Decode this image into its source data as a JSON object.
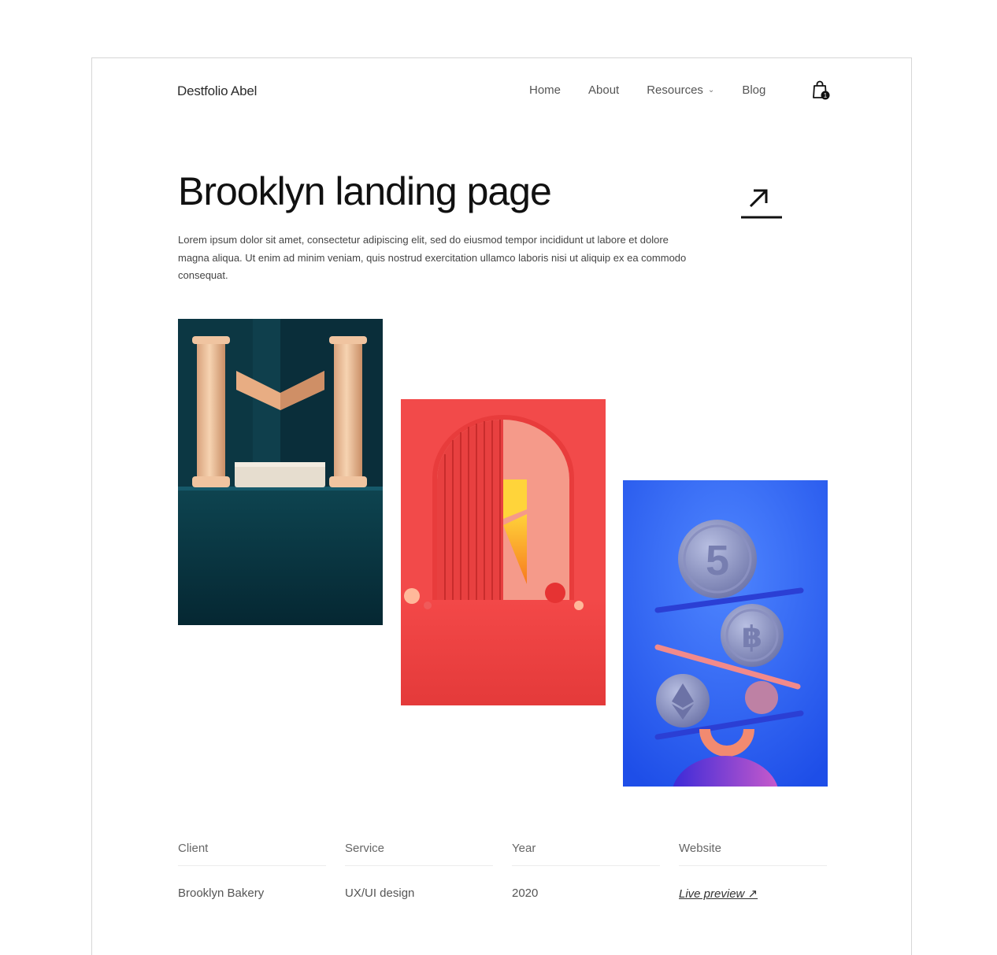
{
  "header": {
    "brand": "Destfolio Abel",
    "nav": [
      {
        "label": "Home"
      },
      {
        "label": "About"
      },
      {
        "label": "Resources"
      },
      {
        "label": "Blog"
      }
    ],
    "cart_count": "1"
  },
  "project": {
    "title": "Brooklyn landing page",
    "description": "Lorem ipsum dolor sit amet, consectetur adipiscing elit, sed do eiusmod tempor incididunt ut labore et dolore magna aliqua. Ut enim ad minim veniam, quis nostrud exercitation ullamco laboris nisi ut aliquip ex ea commodo consequat."
  },
  "gallery": {
    "images": [
      {
        "name": "teal-columns-m-artwork",
        "bg": "#0b3440"
      },
      {
        "name": "red-arch-j-artwork",
        "bg": "#f24a4a"
      },
      {
        "name": "blue-crypto-coins-artwork",
        "bg": "#2a5cf0"
      }
    ],
    "coin_text": "5"
  },
  "meta": {
    "client": {
      "label": "Client",
      "value": "Brooklyn Bakery"
    },
    "service": {
      "label": "Service",
      "value": "UX/UI design"
    },
    "year": {
      "label": "Year",
      "value": "2020"
    },
    "website": {
      "label": "Website",
      "value": "Live preview ↗"
    }
  }
}
